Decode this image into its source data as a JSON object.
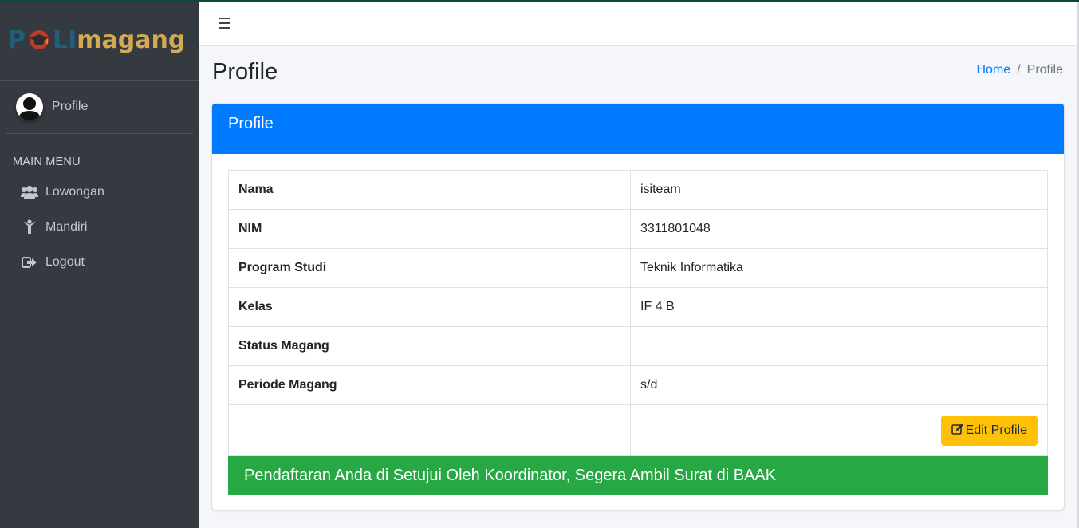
{
  "brand": {
    "part1": "P",
    "part2": "LI",
    "part3": "magang"
  },
  "user": {
    "name": "Profile"
  },
  "nav": {
    "header": "MAIN MENU",
    "items": [
      {
        "label": "Lowongan",
        "icon": "users-icon"
      },
      {
        "label": "Mandiri",
        "icon": "child-icon"
      },
      {
        "label": "Logout",
        "icon": "sign-out-icon"
      }
    ]
  },
  "page": {
    "title": "Profile"
  },
  "breadcrumb": {
    "home": "Home",
    "separator": "/",
    "current": "Profile"
  },
  "card": {
    "title": "Profile",
    "rows": [
      {
        "label": "Nama",
        "value": "isiteam"
      },
      {
        "label": "NIM",
        "value": "3311801048"
      },
      {
        "label": "Program Studi",
        "value": "Teknik Informatika"
      },
      {
        "label": "Kelas",
        "value": "IF 4 B"
      },
      {
        "label": "Status Magang",
        "value": ""
      },
      {
        "label": "Periode Magang",
        "value": "s/d"
      }
    ],
    "edit_button": "Edit Profile",
    "alert": "Pendaftaran Anda di Setujui Oleh Koordinator, Segera Ambil Surat di BAAK"
  },
  "colors": {
    "sidebar": "#343a40",
    "primary": "#007bff",
    "warning": "#ffc107",
    "success": "#28a745",
    "brand_blue": "#1f5f7a",
    "brand_gold": "#d4a953"
  }
}
